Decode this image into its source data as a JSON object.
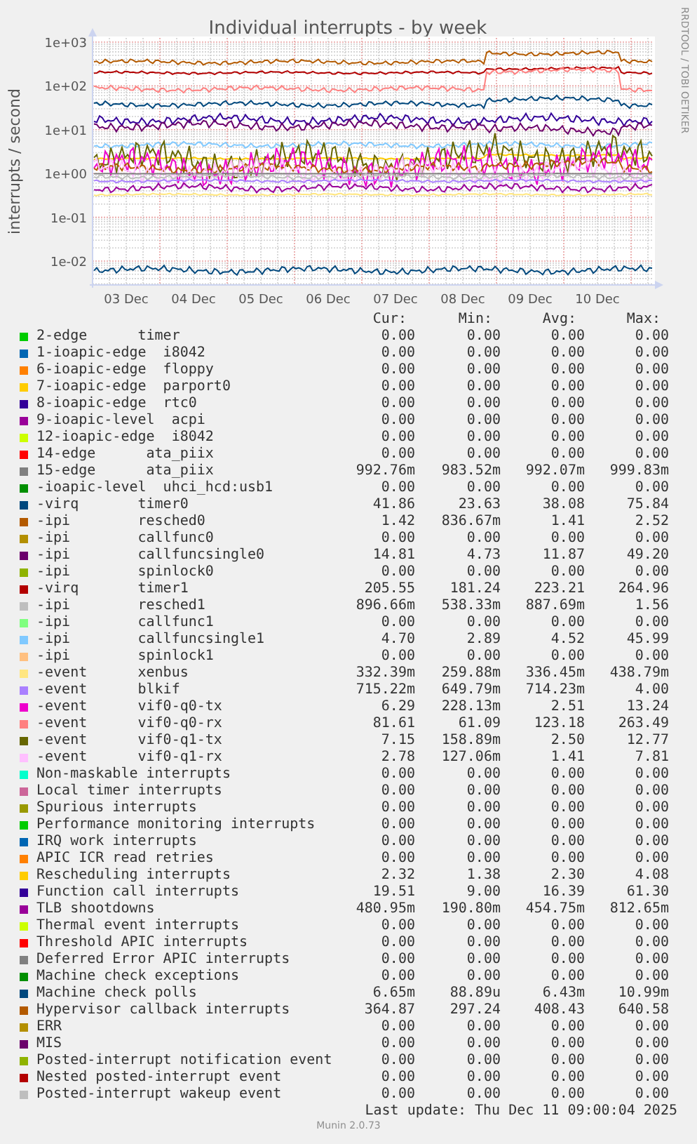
{
  "graph": {
    "title": "Individual interrupts - by week",
    "y_axis_label": "interrupts / second",
    "side_label": "RRDTOOL / TOBI OETIKER",
    "y_ticks": [
      "1e+03",
      "1e+02",
      "1e+01",
      "1e+00",
      "1e-01",
      "1e-02"
    ],
    "x_ticks": [
      "03 Dec",
      "04 Dec",
      "05 Dec",
      "06 Dec",
      "07 Dec",
      "08 Dec",
      "09 Dec",
      "10 Dec"
    ]
  },
  "legend": {
    "columns": [
      "Cur:",
      "Min:",
      "Avg:",
      "Max:"
    ],
    "rows": [
      {
        "label": "2-edge      timer",
        "color": "#00cc00",
        "cur": "0.00",
        "min": "0.00",
        "avg": "0.00",
        "max": "0.00"
      },
      {
        "label": "1-ioapic-edge  i8042",
        "color": "#0066b3",
        "cur": "0.00",
        "min": "0.00",
        "avg": "0.00",
        "max": "0.00"
      },
      {
        "label": "6-ioapic-edge  floppy",
        "color": "#ff8000",
        "cur": "0.00",
        "min": "0.00",
        "avg": "0.00",
        "max": "0.00"
      },
      {
        "label": "7-ioapic-edge  parport0",
        "color": "#ffcc00",
        "cur": "0.00",
        "min": "0.00",
        "avg": "0.00",
        "max": "0.00"
      },
      {
        "label": "8-ioapic-edge  rtc0",
        "color": "#330099",
        "cur": "0.00",
        "min": "0.00",
        "avg": "0.00",
        "max": "0.00"
      },
      {
        "label": "9-ioapic-level  acpi",
        "color": "#990099",
        "cur": "0.00",
        "min": "0.00",
        "avg": "0.00",
        "max": "0.00"
      },
      {
        "label": "12-ioapic-edge  i8042",
        "color": "#ccff00",
        "cur": "0.00",
        "min": "0.00",
        "avg": "0.00",
        "max": "0.00"
      },
      {
        "label": "14-edge      ata_piix",
        "color": "#ff0000",
        "cur": "0.00",
        "min": "0.00",
        "avg": "0.00",
        "max": "0.00"
      },
      {
        "label": "15-edge      ata_piix",
        "color": "#808080",
        "cur": "992.76m",
        "min": "983.52m",
        "avg": "992.07m",
        "max": "999.83m"
      },
      {
        "label": "-ioapic-level  uhci_hcd:usb1",
        "color": "#008f00",
        "cur": "0.00",
        "min": "0.00",
        "avg": "0.00",
        "max": "0.00"
      },
      {
        "label": "-virq       timer0",
        "color": "#00487d",
        "cur": "41.86",
        "min": "23.63",
        "avg": "38.08",
        "max": "75.84"
      },
      {
        "label": "-ipi        resched0",
        "color": "#b35a00",
        "cur": "1.42",
        "min": "836.67m",
        "avg": "1.41",
        "max": "2.52"
      },
      {
        "label": "-ipi        callfunc0",
        "color": "#b38f00",
        "cur": "0.00",
        "min": "0.00",
        "avg": "0.00",
        "max": "0.00"
      },
      {
        "label": "-ipi        callfuncsingle0",
        "color": "#6b006b",
        "cur": "14.81",
        "min": "4.73",
        "avg": "11.87",
        "max": "49.20"
      },
      {
        "label": "-ipi        spinlock0",
        "color": "#8fb300",
        "cur": "0.00",
        "min": "0.00",
        "avg": "0.00",
        "max": "0.00"
      },
      {
        "label": "-virq       timer1",
        "color": "#b30000",
        "cur": "205.55",
        "min": "181.24",
        "avg": "223.21",
        "max": "264.96"
      },
      {
        "label": "-ipi        resched1",
        "color": "#bebebe",
        "cur": "896.66m",
        "min": "538.33m",
        "avg": "887.69m",
        "max": "1.56"
      },
      {
        "label": "-ipi        callfunc1",
        "color": "#80ff80",
        "cur": "0.00",
        "min": "0.00",
        "avg": "0.00",
        "max": "0.00"
      },
      {
        "label": "-ipi        callfuncsingle1",
        "color": "#80c9ff",
        "cur": "4.70",
        "min": "2.89",
        "avg": "4.52",
        "max": "45.99"
      },
      {
        "label": "-ipi        spinlock1",
        "color": "#ffc080",
        "cur": "0.00",
        "min": "0.00",
        "avg": "0.00",
        "max": "0.00"
      },
      {
        "label": "-event      xenbus",
        "color": "#ffe680",
        "cur": "332.39m",
        "min": "259.88m",
        "avg": "336.45m",
        "max": "438.79m"
      },
      {
        "label": "-event      blkif",
        "color": "#aa80ff",
        "cur": "715.22m",
        "min": "649.79m",
        "avg": "714.23m",
        "max": "4.00"
      },
      {
        "label": "-event      vif0-q0-tx",
        "color": "#ee00cc",
        "cur": "6.29",
        "min": "228.13m",
        "avg": "2.51",
        "max": "13.24"
      },
      {
        "label": "-event      vif0-q0-rx",
        "color": "#ff8080",
        "cur": "81.61",
        "min": "61.09",
        "avg": "123.18",
        "max": "263.49"
      },
      {
        "label": "-event      vif0-q1-tx",
        "color": "#666600",
        "cur": "7.15",
        "min": "158.89m",
        "avg": "2.50",
        "max": "12.77"
      },
      {
        "label": "-event      vif0-q1-rx",
        "color": "#ffbfff",
        "cur": "2.78",
        "min": "127.06m",
        "avg": "1.41",
        "max": "7.81"
      },
      {
        "label": "Non-maskable interrupts",
        "color": "#00ffcc",
        "cur": "0.00",
        "min": "0.00",
        "avg": "0.00",
        "max": "0.00"
      },
      {
        "label": "Local timer interrupts",
        "color": "#cc6699",
        "cur": "0.00",
        "min": "0.00",
        "avg": "0.00",
        "max": "0.00"
      },
      {
        "label": "Spurious interrupts",
        "color": "#999900",
        "cur": "0.00",
        "min": "0.00",
        "avg": "0.00",
        "max": "0.00"
      },
      {
        "label": "Performance monitoring interrupts",
        "color": "#00cc00",
        "cur": "0.00",
        "min": "0.00",
        "avg": "0.00",
        "max": "0.00"
      },
      {
        "label": "IRQ work interrupts",
        "color": "#0066b3",
        "cur": "0.00",
        "min": "0.00",
        "avg": "0.00",
        "max": "0.00"
      },
      {
        "label": "APIC ICR read retries",
        "color": "#ff8000",
        "cur": "0.00",
        "min": "0.00",
        "avg": "0.00",
        "max": "0.00"
      },
      {
        "label": "Rescheduling interrupts",
        "color": "#ffcc00",
        "cur": "2.32",
        "min": "1.38",
        "avg": "2.30",
        "max": "4.08"
      },
      {
        "label": "Function call interrupts",
        "color": "#330099",
        "cur": "19.51",
        "min": "9.00",
        "avg": "16.39",
        "max": "61.30"
      },
      {
        "label": "TLB shootdowns",
        "color": "#990099",
        "cur": "480.95m",
        "min": "190.80m",
        "avg": "454.75m",
        "max": "812.65m"
      },
      {
        "label": "Thermal event interrupts",
        "color": "#ccff00",
        "cur": "0.00",
        "min": "0.00",
        "avg": "0.00",
        "max": "0.00"
      },
      {
        "label": "Threshold APIC interrupts",
        "color": "#ff0000",
        "cur": "0.00",
        "min": "0.00",
        "avg": "0.00",
        "max": "0.00"
      },
      {
        "label": "Deferred Error APIC interrupts",
        "color": "#808080",
        "cur": "0.00",
        "min": "0.00",
        "avg": "0.00",
        "max": "0.00"
      },
      {
        "label": "Machine check exceptions",
        "color": "#008f00",
        "cur": "0.00",
        "min": "0.00",
        "avg": "0.00",
        "max": "0.00"
      },
      {
        "label": "Machine check polls",
        "color": "#00487d",
        "cur": "6.65m",
        "min": "88.89u",
        "avg": "6.43m",
        "max": "10.99m"
      },
      {
        "label": "Hypervisor callback interrupts",
        "color": "#b35a00",
        "cur": "364.87",
        "min": "297.24",
        "avg": "408.43",
        "max": "640.58"
      },
      {
        "label": "ERR",
        "color": "#b38f00",
        "cur": "0.00",
        "min": "0.00",
        "avg": "0.00",
        "max": "0.00"
      },
      {
        "label": "MIS",
        "color": "#6b006b",
        "cur": "0.00",
        "min": "0.00",
        "avg": "0.00",
        "max": "0.00"
      },
      {
        "label": "Posted-interrupt notification event",
        "color": "#8fb300",
        "cur": "0.00",
        "min": "0.00",
        "avg": "0.00",
        "max": "0.00"
      },
      {
        "label": "Nested posted-interrupt event",
        "color": "#b30000",
        "cur": "0.00",
        "min": "0.00",
        "avg": "0.00",
        "max": "0.00"
      },
      {
        "label": "Posted-interrupt wakeup event",
        "color": "#bebebe",
        "cur": "0.00",
        "min": "0.00",
        "avg": "0.00",
        "max": "0.00"
      }
    ]
  },
  "last_update": "Last update: Thu Dec 11 09:00:04 2025",
  "footer": "Munin 2.0.73"
}
